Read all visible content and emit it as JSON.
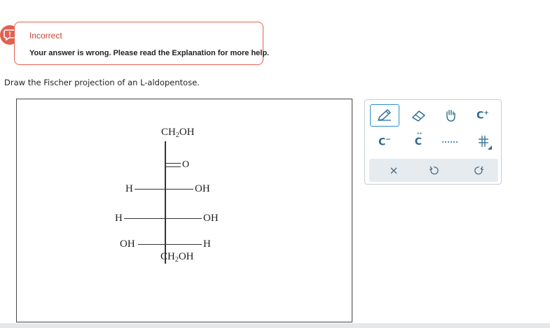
{
  "feedback": {
    "title": "Incorrect",
    "message": "Your answer is wrong. Please read the Explanation for more help.",
    "icon": "chat-alert-icon",
    "color": "#e2604f"
  },
  "question": {
    "prompt": "Draw the Fischer projection of an L-aldopentose."
  },
  "structure": {
    "top_group": "CH",
    "top_sub": "2",
    "top_tail": "OH",
    "carbonyl_label": "O",
    "row1_left": "H",
    "row1_right": "OH",
    "row2_left": "H",
    "row2_right": "OH",
    "row3_left": "OH",
    "row3_right": "H",
    "bottom_group": "CH",
    "bottom_sub": "2",
    "bottom_tail": "OH"
  },
  "toolbar": {
    "tools": [
      {
        "name": "pencil-tool",
        "icon": "pencil-icon",
        "active": true
      },
      {
        "name": "eraser-tool",
        "icon": "eraser-icon"
      },
      {
        "name": "hand-tool",
        "icon": "hand-icon"
      },
      {
        "name": "positive-charge-tool",
        "icon": "carbocation-icon",
        "label": "C",
        "sup": "+"
      },
      {
        "name": "negative-charge-tool",
        "icon": "carbanion-icon",
        "label": "C",
        "sup": "−"
      },
      {
        "name": "radical-tool",
        "icon": "lone-pair-icon",
        "label": "C"
      },
      {
        "name": "dotted-bond-tool",
        "icon": "dotted-bond-icon"
      },
      {
        "name": "fischer-template-tool",
        "icon": "fischer-cross-icon"
      }
    ],
    "actions": [
      {
        "name": "clear-button",
        "icon": "close-icon"
      },
      {
        "name": "undo-button",
        "icon": "undo-icon"
      },
      {
        "name": "redo-button",
        "icon": "redo-icon"
      }
    ],
    "accent": "#2b8fc9"
  }
}
